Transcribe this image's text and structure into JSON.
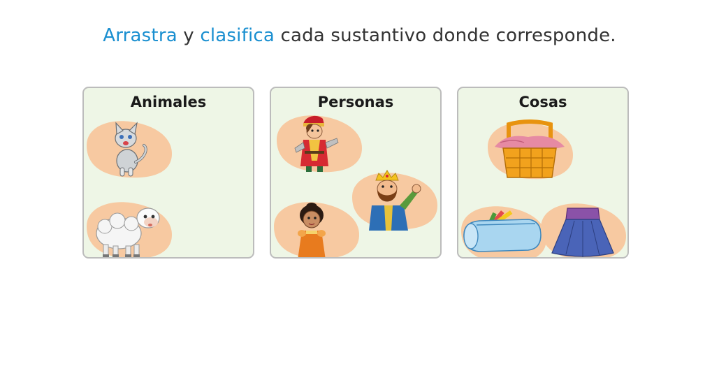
{
  "instruction": {
    "word1": "Arrastra",
    "word2": " y ",
    "word3": "clasifica",
    "rest": " cada sustantivo donde corresponde."
  },
  "categories": [
    {
      "title": "Animales",
      "items": [
        "cat",
        "sheep"
      ]
    },
    {
      "title": "Personas",
      "items": [
        "prince",
        "king",
        "girl"
      ]
    },
    {
      "title": "Cosas",
      "items": [
        "basket",
        "pencil-case",
        "skirt"
      ]
    }
  ],
  "colors": {
    "accent": "#1a8fd0",
    "box_background": "#eef6e6",
    "box_border": "#bcbcbc",
    "card_blob": "#f7c9a1"
  }
}
